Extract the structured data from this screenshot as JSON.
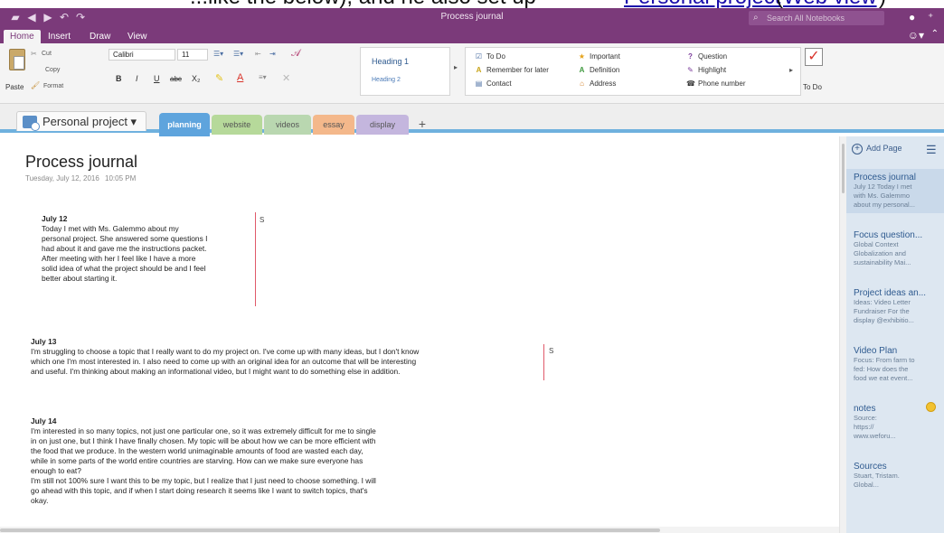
{
  "caption": {
    "lead": "...like the below), and he also set up",
    "link_text": "Personal project",
    "paren_open": "(",
    "link2_text": "Web view",
    "paren_close": ")"
  },
  "window": {
    "title": "Process journal",
    "search_placeholder": "Search All Notebooks"
  },
  "ribbon_tabs": [
    "Home",
    "Insert",
    "Draw",
    "View"
  ],
  "ribbon": {
    "paste": "Paste",
    "cut": "Cut",
    "copy": "Copy",
    "format": "Format",
    "font_name": "Calibri",
    "font_size": "11",
    "bold": "B",
    "italic": "I",
    "underline": "U",
    "strike": "abc",
    "subscript": "X₂",
    "style_heading1": "Heading 1",
    "style_heading2": "Heading 2",
    "tags": {
      "todo": "To Do",
      "remember": "Remember for later",
      "contact": "Contact",
      "important": "Important",
      "definition": "Definition",
      "address": "Address",
      "question": "Question",
      "highlight": "Highlight",
      "phone": "Phone number"
    },
    "todo_big": "To Do"
  },
  "notebook": {
    "name": "Personal project ▾",
    "sections": [
      {
        "label": "planning",
        "color": "#5ea4dd"
      },
      {
        "label": "website",
        "color": "#b6d99a"
      },
      {
        "label": "videos",
        "color": "#b9d7b0"
      },
      {
        "label": "essay",
        "color": "#f4b88b"
      },
      {
        "label": "display",
        "color": "#c4b6de"
      }
    ],
    "add_section": "+"
  },
  "page": {
    "title": "Process journal",
    "date": "Tuesday, July 12, 2016",
    "time": "10:05 PM",
    "entries": [
      {
        "heading": "July 12",
        "lines": [
          "Today I met with Ms. Galemmo about my",
          "personal project. She answered some questions I",
          "had about it and gave me the instructions packet.",
          "After meeting with her I feel like I have a more",
          "solid idea of what the project should be and I feel",
          "better about starting it."
        ],
        "note": "S"
      },
      {
        "heading": "July 13",
        "lines": [
          "I'm struggling to choose a topic that I really want to do my project on. I've come up with many ideas, but I don't know",
          "which one I'm most interested in. I also need to come up with an original idea for an outcome that will be interesting",
          "and useful. I'm thinking about making an informational video, but I might want to do something else in addition."
        ],
        "note": "S"
      },
      {
        "heading": "July 14",
        "lines": [
          "I'm interested in so many topics, not just one particular one, so it was extremely difficult for me to single",
          "in on just one, but I think I have finally chosen. My topic will be about how we can be more efficient with",
          "the food that we produce. In the western world unimaginable amounts of food are wasted each day,",
          "while in some parts of the world entire countries are starving. How can we make sure everyone has",
          "enough to eat?",
          "I'm still not 100% sure I want this to be my topic, but I realize that I just need to choose something. I will",
          "go ahead with this topic, and if when I start doing research it seems like I want to switch topics, that's",
          "okay."
        ],
        "note": ""
      }
    ]
  },
  "pages_pane": {
    "add_page": "Add Page",
    "items": [
      {
        "title": "Process journal",
        "sub": [
          "July 12 Today I met",
          "with Ms. Galemmo",
          "about my personal..."
        ]
      },
      {
        "title": "Focus question...",
        "sub": [
          "Global Context",
          "Globalization and",
          "sustainability Mai..."
        ]
      },
      {
        "title": "Project ideas an...",
        "sub": [
          "Ideas: Video Letter",
          "Fundraiser For the",
          "display @exhibitio..."
        ]
      },
      {
        "title": "Video Plan",
        "sub": [
          "Focus: From farm to",
          "fed: How does the",
          "food we eat event..."
        ]
      },
      {
        "title": "notes",
        "sub": [
          "Source:",
          "https://",
          "www.weforu..."
        ]
      },
      {
        "title": "Sources",
        "sub": [
          "Stuart, Tristam.",
          "Global..."
        ]
      }
    ]
  }
}
